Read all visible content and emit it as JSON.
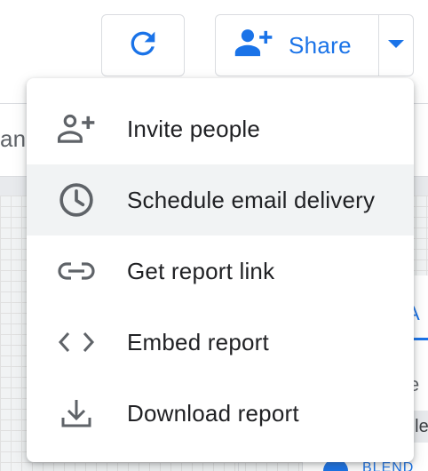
{
  "background": {
    "left_text": "anc",
    "panel_letter_a": "A",
    "panel_letter_e": "e",
    "panel_text_gle": "gle",
    "panel_blend_text": "BLEND"
  },
  "toolbar": {
    "refresh_icon": "refresh-icon",
    "share_icon": "person-add-icon",
    "share_label": "Share",
    "share_dropdown_icon": "arrow-drop-down-icon"
  },
  "menu": {
    "items": [
      {
        "label": "Invite people",
        "icon": "person-add-icon",
        "highlighted": false
      },
      {
        "label": "Schedule email delivery",
        "icon": "clock-icon",
        "highlighted": true
      },
      {
        "label": "Get report link",
        "icon": "link-icon",
        "highlighted": false
      },
      {
        "label": "Embed report",
        "icon": "code-icon",
        "highlighted": false
      },
      {
        "label": "Download report",
        "icon": "download-icon",
        "highlighted": false
      }
    ]
  },
  "colors": {
    "accent": "#1a73e8",
    "icon_gray": "#5f6368",
    "text": "#202124",
    "hover": "#f1f3f4"
  }
}
